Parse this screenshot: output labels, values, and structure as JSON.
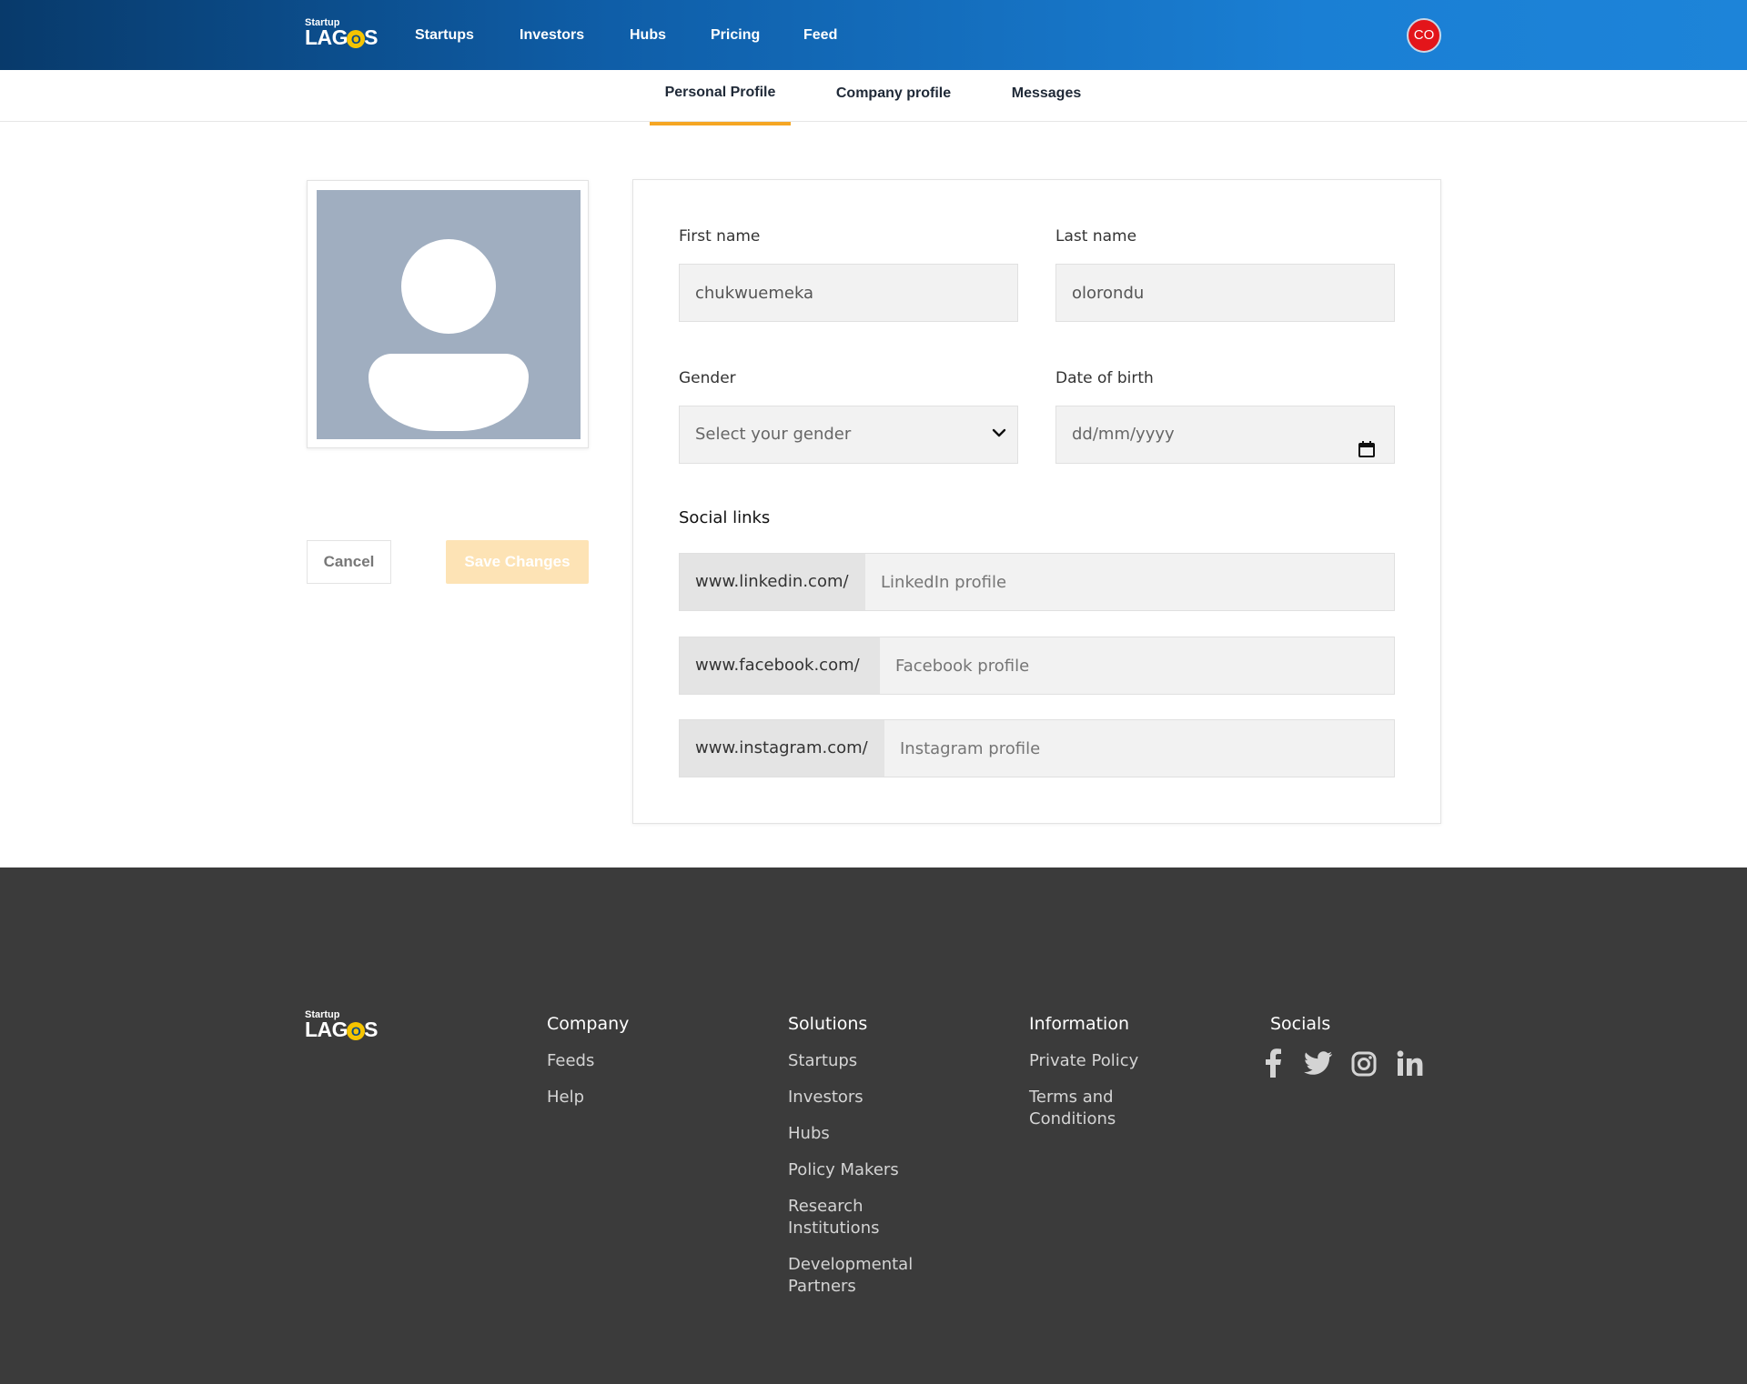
{
  "brand": {
    "small": "Startup",
    "big_pre": "LAG",
    "big_o": "O",
    "big_post": "S"
  },
  "nav": {
    "startups": "Startups",
    "investors": "Investors",
    "hubs": "Hubs",
    "pricing": "Pricing",
    "feed": "Feed"
  },
  "user": {
    "initials": "CO"
  },
  "tabs": {
    "personal": "Personal Profile",
    "company": "Company profile",
    "messages": "Messages"
  },
  "actions": {
    "cancel": "Cancel",
    "save": "Save Changes"
  },
  "form": {
    "first_name_label": "First name",
    "first_name_value": "chukwuemeka",
    "last_name_label": "Last name",
    "last_name_value": "olorondu",
    "gender_label": "Gender",
    "gender_value": "Select your gender",
    "dob_label": "Date of birth",
    "dob_value": "dd/mm/yyyy",
    "social_title": "Social links",
    "linkedin_prefix": "www.linkedin.com/",
    "linkedin_placeholder": "LinkedIn profile",
    "facebook_prefix": "www.facebook.com/",
    "facebook_placeholder": "Facebook profile",
    "instagram_prefix": "www.instagram.com/",
    "instagram_placeholder": "Instagram profile"
  },
  "footer": {
    "company": {
      "title": "Company",
      "links": [
        "Feeds",
        "Help"
      ]
    },
    "solutions": {
      "title": "Solutions",
      "links": [
        "Startups",
        "Investors",
        "Hubs",
        "Policy Makers",
        "Research Institutions",
        "Developmental Partners"
      ]
    },
    "information": {
      "title": "Information",
      "links": [
        "Private Policy",
        "Terms and Conditions"
      ]
    },
    "socials": {
      "title": "Socials",
      "icons": [
        "facebook-icon",
        "twitter-icon",
        "instagram-icon",
        "linkedin-icon"
      ]
    }
  },
  "colors": {
    "header_start": "#083a6b",
    "header_end": "#1d84d9",
    "accent": "#f5a623",
    "footer_bg": "#3b3b3b",
    "avatar_bg": "#e3151a"
  }
}
